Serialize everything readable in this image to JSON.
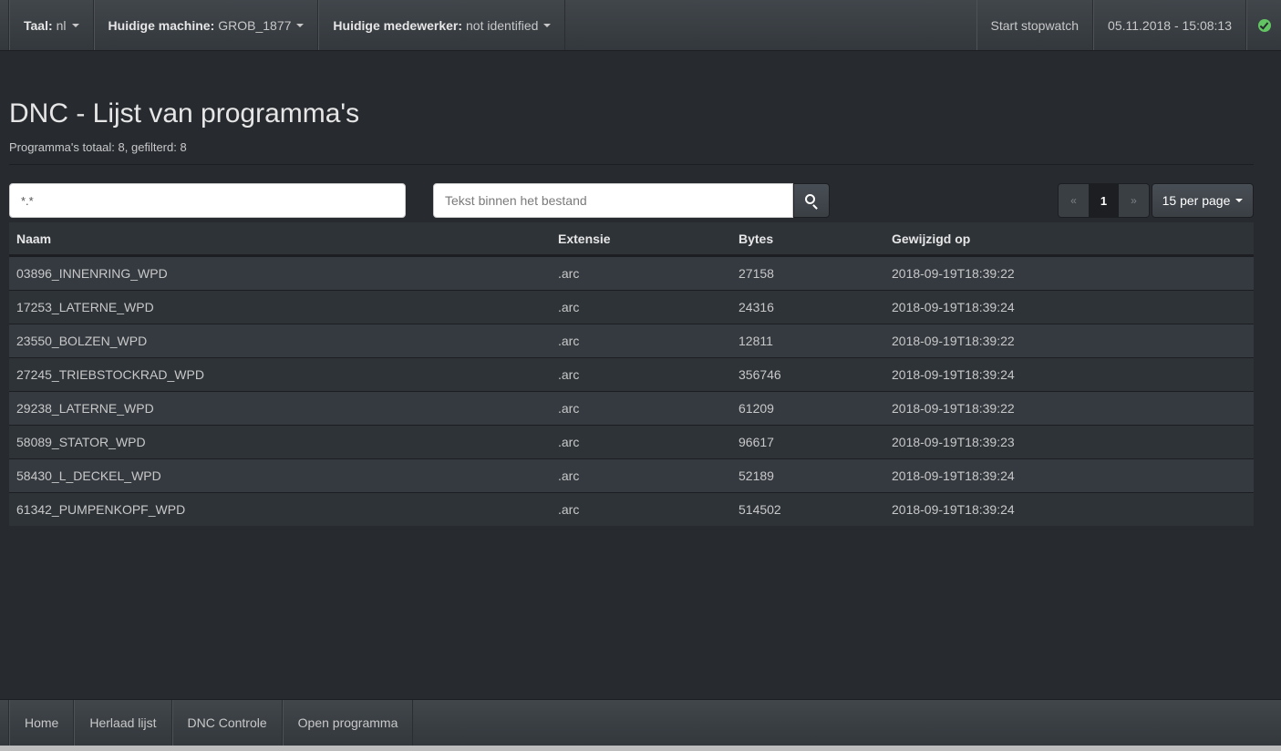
{
  "topbar": {
    "language": {
      "label": "Taal:",
      "value": "nl"
    },
    "machine": {
      "label": "Huidige machine:",
      "value": "GROB_1877"
    },
    "employee": {
      "label": "Huidige medewerker:",
      "value": "not identified"
    },
    "stopwatch": "Start stopwatch",
    "datetime": "05.11.2018 - 15:08:13",
    "status_icon": "check-circle-icon",
    "status_color": "#62c462"
  },
  "header": {
    "title": "DNC - Lijst van programma's",
    "subtitle": "Programma's totaal: 8, gefilterd: 8"
  },
  "filters": {
    "name_filter_value": "*.*",
    "text_search_placeholder": "Tekst binnen het bestand",
    "search_icon": "search-icon"
  },
  "pagination": {
    "prev": "«",
    "current": "1",
    "next": "»",
    "per_page": "15 per page"
  },
  "table": {
    "columns": [
      "Naam",
      "Extensie",
      "Bytes",
      "Gewijzigd op"
    ],
    "rows": [
      [
        "03896_INNENRING_WPD",
        ".arc",
        "27158",
        "2018-09-19T18:39:22"
      ],
      [
        "17253_LATERNE_WPD",
        ".arc",
        "24316",
        "2018-09-19T18:39:24"
      ],
      [
        "23550_BOLZEN_WPD",
        ".arc",
        "12811",
        "2018-09-19T18:39:22"
      ],
      [
        "27245_TRIEBSTOCKRAD_WPD",
        ".arc",
        "356746",
        "2018-09-19T18:39:24"
      ],
      [
        "29238_LATERNE_WPD",
        ".arc",
        "61209",
        "2018-09-19T18:39:22"
      ],
      [
        "58089_STATOR_WPD",
        ".arc",
        "96617",
        "2018-09-19T18:39:23"
      ],
      [
        "58430_L_DECKEL_WPD",
        ".arc",
        "52189",
        "2018-09-19T18:39:24"
      ],
      [
        "61342_PUMPENKOPF_WPD",
        ".arc",
        "514502",
        "2018-09-19T18:39:24"
      ]
    ]
  },
  "bottombar": {
    "items": [
      "Home",
      "Herlaad lijst",
      "DNC Controle",
      "Open programma"
    ]
  }
}
